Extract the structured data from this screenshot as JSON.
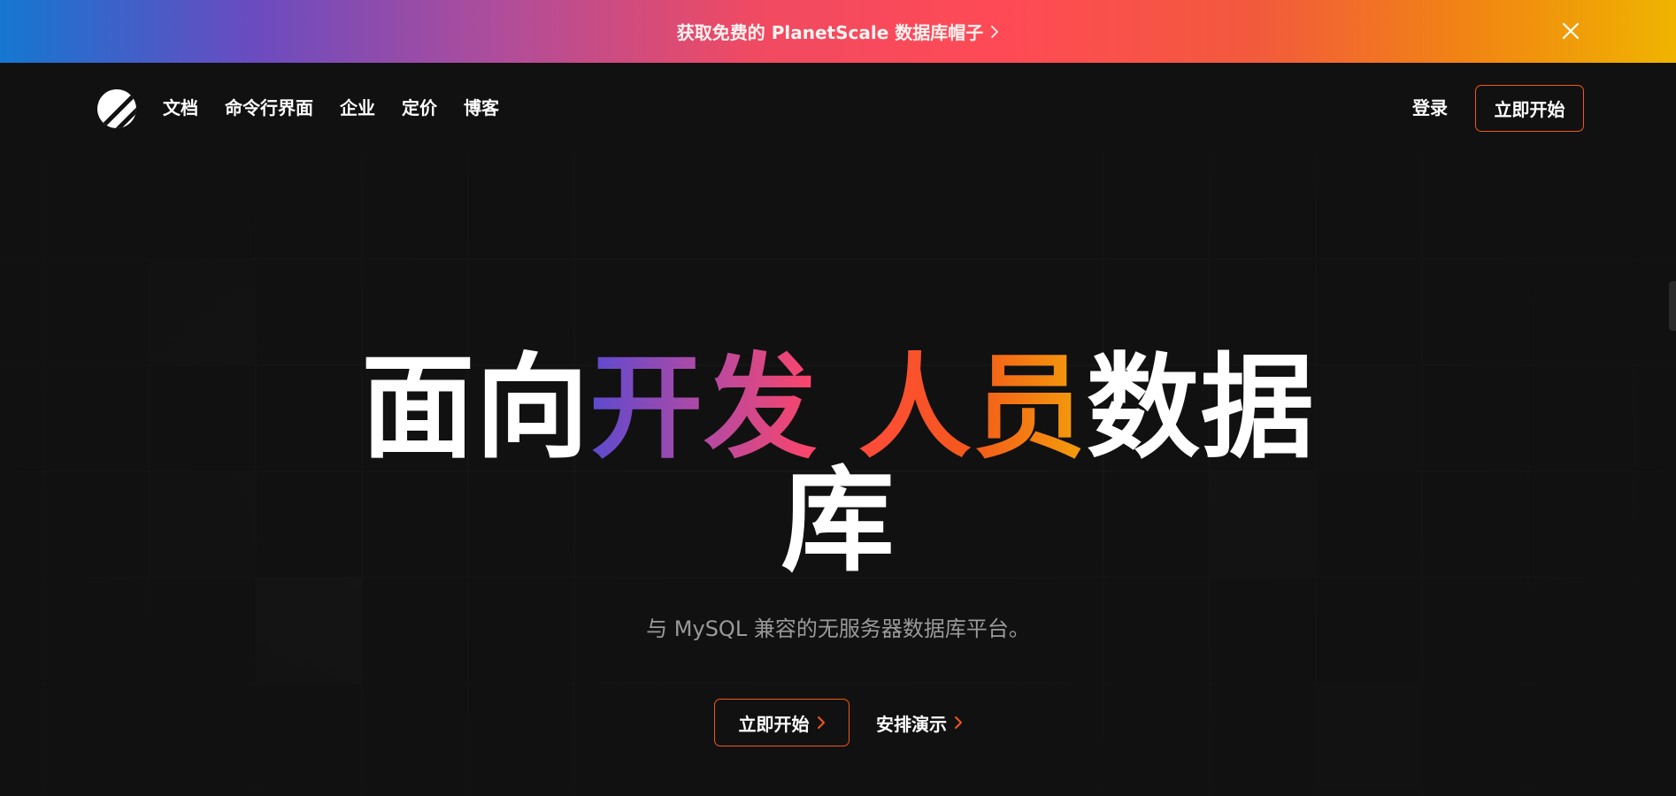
{
  "banner": {
    "text": "获取免费的 PlanetScale 数据库帽子",
    "background_colors": [
      "#1477d1",
      "#6a4bc0",
      "#f04a62",
      "#f25a3c",
      "#f0b400"
    ],
    "icons": {
      "chevron": "chevron-right-icon",
      "close": "close-icon"
    }
  },
  "nav": {
    "logo_icon": "planetscale-logo",
    "links": [
      "文档",
      "命令行界面",
      "企业",
      "定价",
      "博客"
    ],
    "signin_label": "登录",
    "cta_label": "立即开始"
  },
  "hero": {
    "title_part_white_1": "面向",
    "title_part_grad_1": "开发",
    "title_part_grad_2": "人员",
    "title_part_white_2": "数据",
    "title_line_2": "库",
    "subtitle": "与 MySQL 兼容的无服务器数据库平台。",
    "primary_cta": "立即开始",
    "secondary_cta": "安排演示"
  },
  "colors": {
    "background": "#111111",
    "accent_orange": "#f35815",
    "text_muted": "#9a9a9a"
  }
}
